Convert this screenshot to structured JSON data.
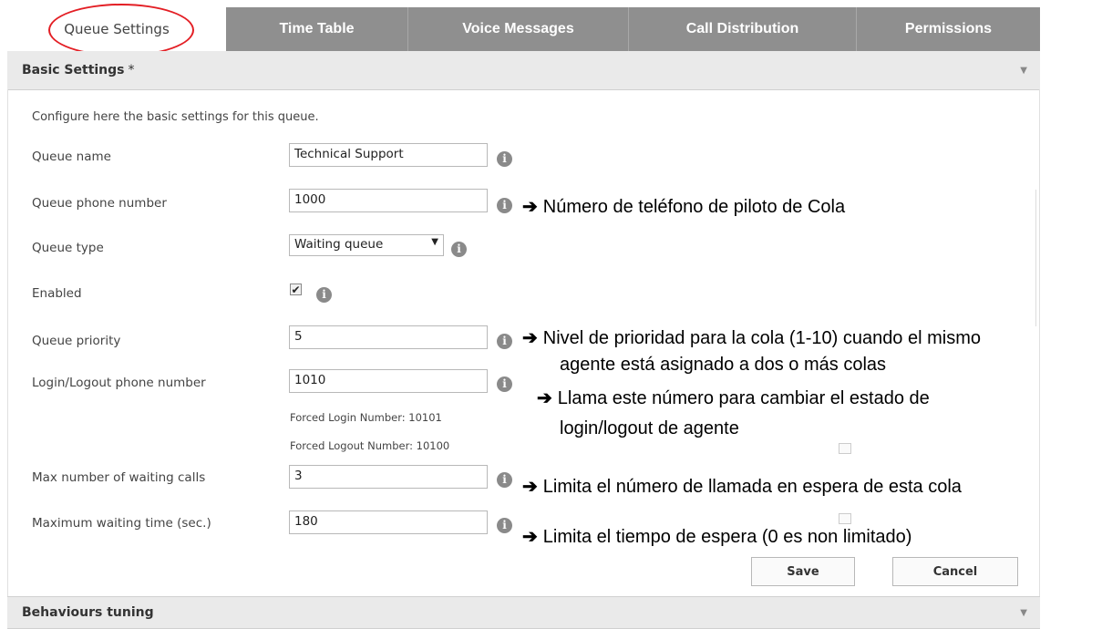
{
  "tabs": [
    {
      "label": "Queue Settings",
      "active": true
    },
    {
      "label": "Time Table"
    },
    {
      "label": "Voice Messages"
    },
    {
      "label": "Call Distribution"
    },
    {
      "label": "Permissions"
    }
  ],
  "basic_section": {
    "title": "Basic Settings",
    "required_marker": "*"
  },
  "intro": "Configure here the basic settings for this queue.",
  "fields": {
    "queue_name": {
      "label": "Queue name",
      "value": "Technical Support"
    },
    "queue_phone": {
      "label": "Queue phone number",
      "value": "1000"
    },
    "queue_type": {
      "label": "Queue type",
      "value": "Waiting queue"
    },
    "enabled": {
      "label": "Enabled",
      "checked": true
    },
    "queue_priority": {
      "label": "Queue priority",
      "value": "5"
    },
    "login_logout": {
      "label": "Login/Logout phone number",
      "value": "1010",
      "forced_login": "Forced Login Number: 10101",
      "forced_logout": "Forced Logout Number: 10100"
    },
    "max_waiting_calls": {
      "label": "Max number of waiting calls",
      "value": "3"
    },
    "max_waiting_time": {
      "label": "Maximum waiting time (sec.)",
      "value": "180"
    }
  },
  "annotations": {
    "phone": "Número de teléfono de piloto de Cola",
    "priority_1": "Nivel de prioridad para la cola (1-10) cuando el mismo",
    "priority_2": "agente está asignado a dos o más colas",
    "login_1": "Llama este número para cambiar el estado de",
    "login_2": "login/logout de agente",
    "max_calls": "Limita el número de llamada en espera de esta cola",
    "max_time": "Limita el tiempo de espera (0 es non limitado)",
    "arrow": "➔"
  },
  "buttons": {
    "save": "Save",
    "cancel": "Cancel"
  },
  "behaviours_section": {
    "title": "Behaviours tuning"
  },
  "icons": {
    "info": "i",
    "chevron": "▼",
    "check": "✔"
  },
  "colors": {
    "tab_bar": "#8f8f8f",
    "highlight": "#e31e24"
  }
}
